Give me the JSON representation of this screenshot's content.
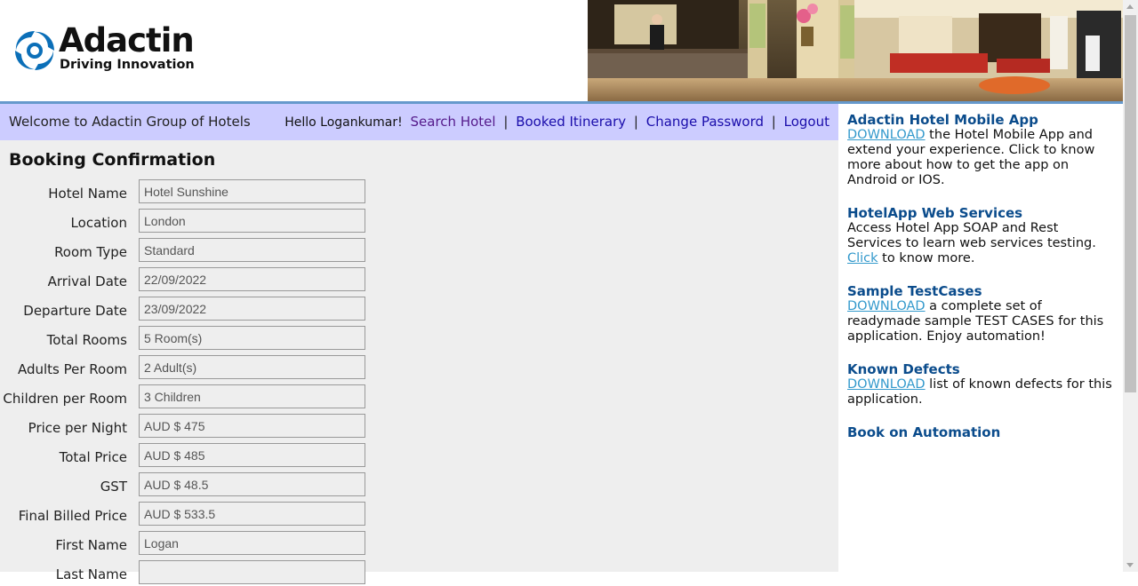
{
  "header": {
    "logo_title": "Adactin",
    "logo_subtitle": "Driving Innovation"
  },
  "nav": {
    "welcome": "Welcome to Adactin Group of Hotels",
    "hello": "Hello Logankumar!",
    "links": {
      "search_hotel": "Search Hotel",
      "booked_itinerary": "Booked Itinerary",
      "change_password": "Change Password",
      "logout": "Logout"
    },
    "separator": "|"
  },
  "page": {
    "title": "Booking Confirmation"
  },
  "form": {
    "fields": [
      {
        "label": "Hotel Name",
        "value": "Hotel Sunshine"
      },
      {
        "label": "Location",
        "value": "London"
      },
      {
        "label": "Room Type",
        "value": "Standard"
      },
      {
        "label": "Arrival Date",
        "value": "22/09/2022"
      },
      {
        "label": "Departure Date",
        "value": "23/09/2022"
      },
      {
        "label": "Total Rooms",
        "value": "5 Room(s)"
      },
      {
        "label": "Adults Per Room",
        "value": "2 Adult(s)"
      },
      {
        "label": "Children per Room",
        "value": "3 Children"
      },
      {
        "label": "Price per Night",
        "value": "AUD $ 475"
      },
      {
        "label": "Total Price",
        "value": "AUD $ 485"
      },
      {
        "label": "GST",
        "value": "AUD $ 48.5"
      },
      {
        "label": "Final Billed Price",
        "value": "AUD $ 533.5"
      },
      {
        "label": "First Name",
        "value": "Logan"
      },
      {
        "label": "Last Name",
        "value": ""
      }
    ]
  },
  "sidebar": {
    "mobile": {
      "heading": "Adactin Hotel Mobile App",
      "link": "DOWNLOAD",
      "text": " the Hotel Mobile App and extend your experience. Click to know more about how to get the app on Android or IOS."
    },
    "webservices": {
      "heading": "HotelApp Web Services",
      "text_before": "Access Hotel App SOAP and Rest Services to learn web services testing. ",
      "link": "Click",
      "text_after": " to know more."
    },
    "testcases": {
      "heading": "Sample TestCases",
      "link": "DOWNLOAD",
      "text": " a complete set of readymade sample TEST CASES for this application. Enjoy automation!"
    },
    "defects": {
      "heading": "Known Defects",
      "link": "DOWNLOAD",
      "text": " list of known defects for this application."
    },
    "book": {
      "heading": "Book on Automation"
    }
  },
  "colors": {
    "navbar_bg": "#ccccff",
    "main_bg": "#eeeeee",
    "header_rule": "#6699cc",
    "sidebar_heading": "#0b4c8c",
    "sidebar_link": "#3399cc"
  }
}
